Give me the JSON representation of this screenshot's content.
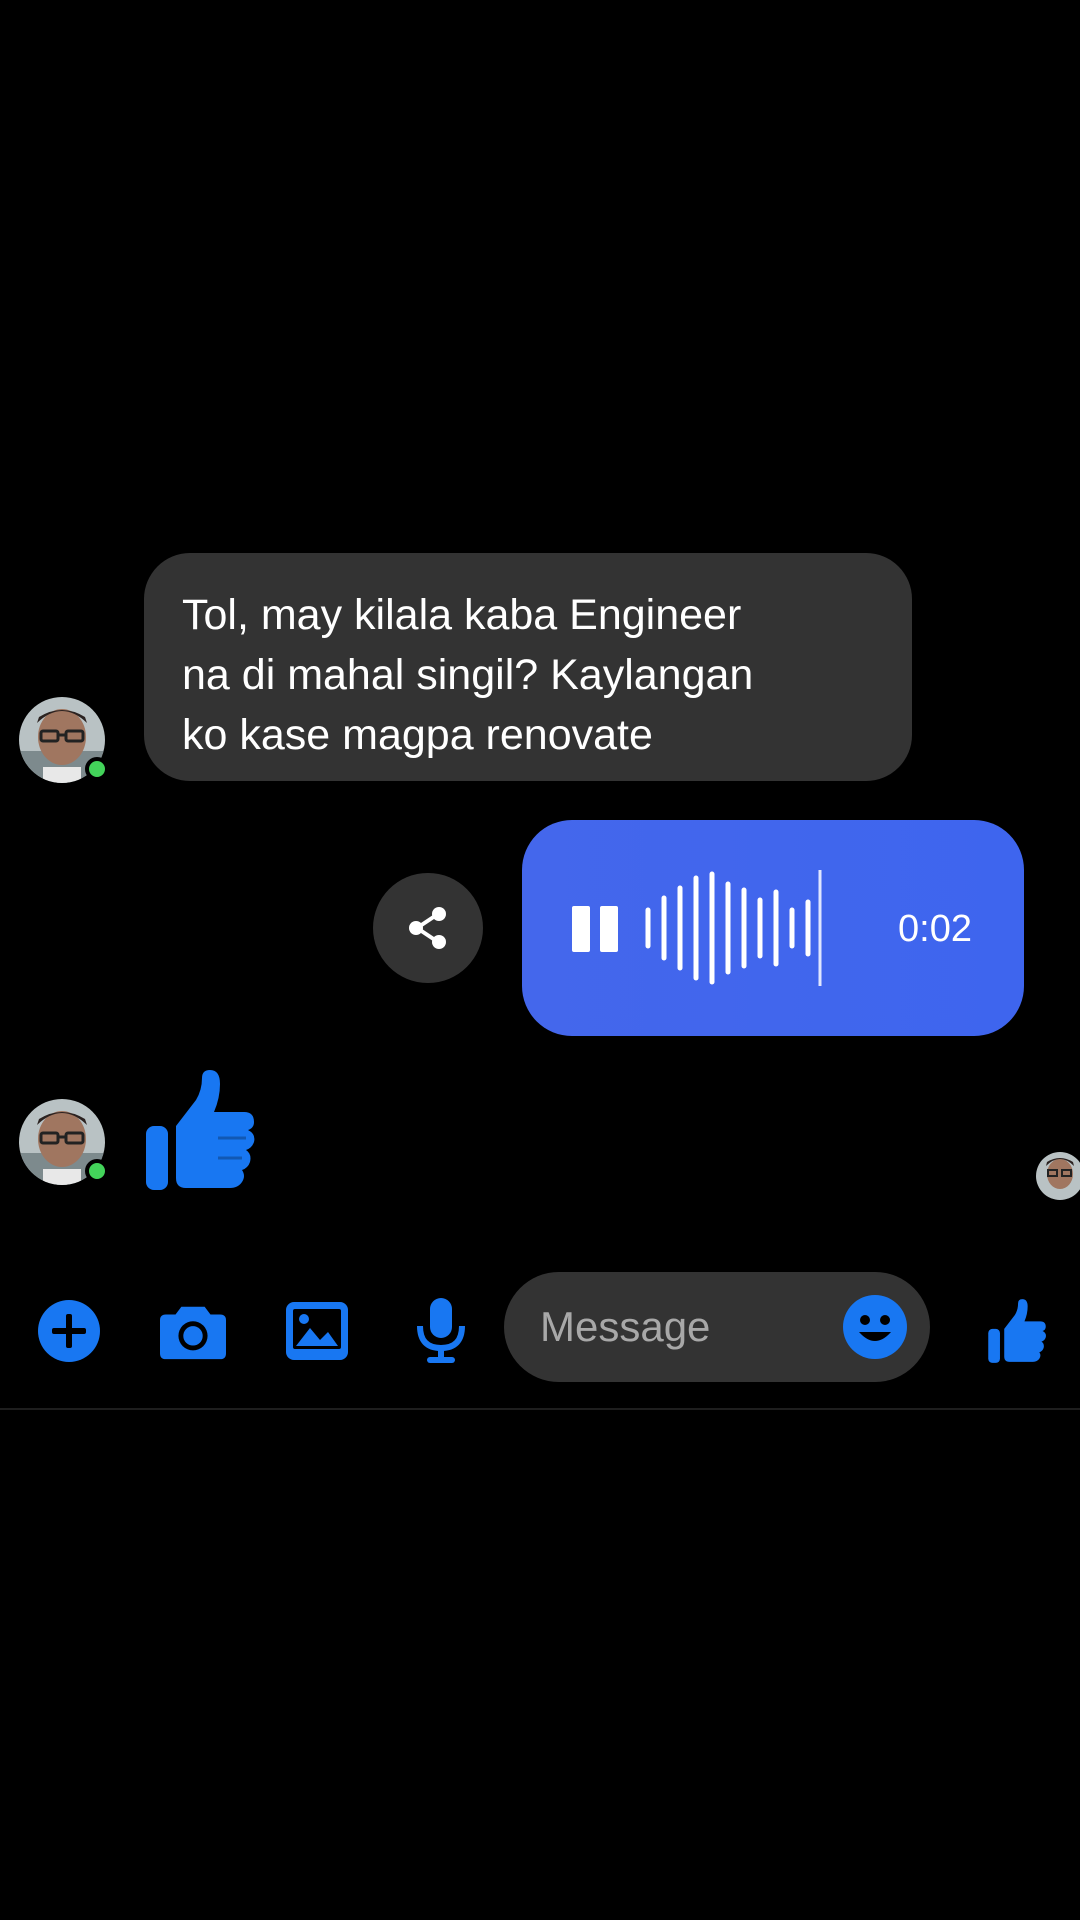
{
  "conversation": {
    "incoming_message": "Tol, may kilala kaba Engineer\nna di mahal singil? Kaylangan\nko kase magpa renovate",
    "voice_message": {
      "duration": "0:02",
      "state": "playing",
      "progress": 1.0
    },
    "incoming_like": "thumbs-up-icon"
  },
  "composer": {
    "placeholder": "Message",
    "value": "",
    "icons": [
      "plus-icon",
      "camera-icon",
      "gallery-icon",
      "microphone-icon",
      "emoji-icon",
      "thumbs-up-icon"
    ]
  },
  "colors": {
    "background": "#000000",
    "bubble_incoming": "#333333",
    "bubble_outgoing": "#4467ec",
    "accent": "#1877f2",
    "online": "#43d35a"
  }
}
